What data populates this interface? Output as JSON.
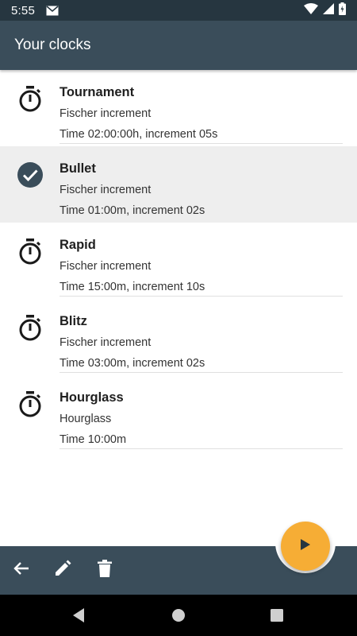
{
  "status_bar": {
    "time": "5:55"
  },
  "app_bar": {
    "title": "Your clocks"
  },
  "clocks": [
    {
      "name": "Tournament",
      "mode": "Fischer increment",
      "detail": "Time 02:00:00h, increment 05s",
      "selected": false,
      "icon": "stopwatch-icon"
    },
    {
      "name": "Bullet",
      "mode": "Fischer increment",
      "detail": "Time 01:00m, increment 02s",
      "selected": true,
      "icon": "check-circle-icon"
    },
    {
      "name": "Rapid",
      "mode": "Fischer increment",
      "detail": "Time 15:00m, increment 10s",
      "selected": false,
      "icon": "stopwatch-icon"
    },
    {
      "name": "Blitz",
      "mode": "Fischer increment",
      "detail": "Time 03:00m, increment 02s",
      "selected": false,
      "icon": "stopwatch-icon"
    },
    {
      "name": "Hourglass",
      "mode": "Hourglass",
      "detail": "Time 10:00m",
      "selected": false,
      "icon": "stopwatch-icon"
    }
  ],
  "bottom_bar": {
    "actions": [
      "back-arrow-icon",
      "edit-icon",
      "delete-icon"
    ]
  },
  "fab": {
    "icon": "play-icon"
  },
  "colors": {
    "app_bar": "#3a4d5a",
    "status_bar": "#263640",
    "accent": "#f6ad35",
    "selected_row": "#eeeeee"
  }
}
